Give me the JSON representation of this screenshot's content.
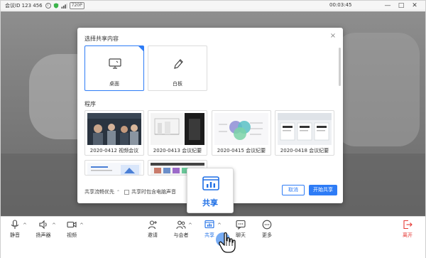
{
  "titlebar": {
    "meeting_id": "会议ID 123 456",
    "resolution_badge": "720P",
    "timer": "00:03:45",
    "minimize": "—",
    "maximize": "□",
    "close": "✕"
  },
  "dialog": {
    "title": "选择共享内容",
    "close": "×",
    "top_tiles": [
      {
        "label": "桌面",
        "icon": "monitor-icon",
        "selected": true
      },
      {
        "label": "白板",
        "icon": "pencil-icon",
        "selected": false
      }
    ],
    "section_label": "程序",
    "apps": [
      {
        "label": "2020-0412 视频会议"
      },
      {
        "label": "2020-0413 会议纪要"
      },
      {
        "label": "2020-0415 会议纪要"
      },
      {
        "label": "2020-0418 会议纪要"
      }
    ],
    "footer": {
      "fluency_label": "共享流畅优先",
      "fluency_caret": "⌃",
      "include_audio_label": "共享时包含电脑声音",
      "cancel_label": "取消",
      "start_label": "开始共享"
    }
  },
  "callout": {
    "label": "共享",
    "icon": "share-screen-icon"
  },
  "toolbar": {
    "caret": "^",
    "items": [
      {
        "label": "静音",
        "icon": "microphone-icon"
      },
      {
        "label": "扬声器",
        "icon": "speaker-icon"
      },
      {
        "label": "视频",
        "icon": "camera-icon"
      },
      {
        "label": "邀请",
        "icon": "invite-icon"
      },
      {
        "label": "与会者",
        "icon": "participants-icon"
      },
      {
        "label": "共享",
        "icon": "share-screen-icon"
      },
      {
        "label": "聊天",
        "icon": "chat-icon"
      },
      {
        "label": "更多",
        "icon": "more-icon"
      },
      {
        "label": "离开",
        "icon": "leave-icon"
      }
    ]
  },
  "colors": {
    "accent": "#2e7cf6",
    "share_active": "#1f6fe6",
    "leave": "#e53935"
  }
}
